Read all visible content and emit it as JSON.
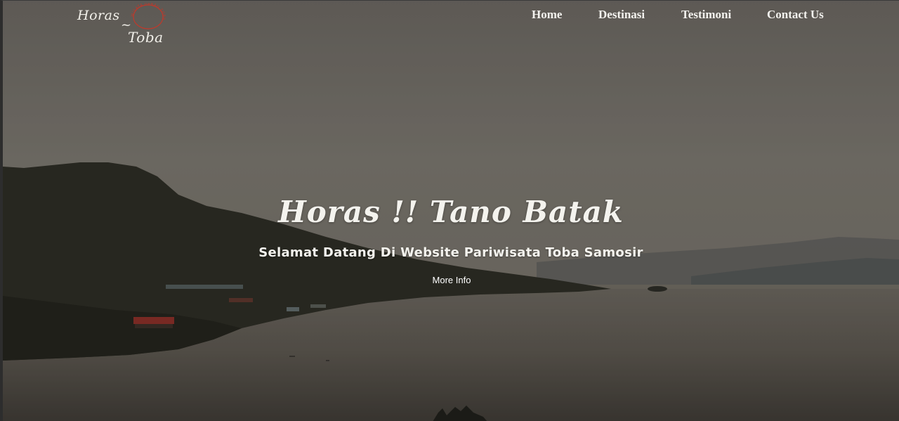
{
  "logo": {
    "line1": "Horas",
    "separator": "~",
    "line2": "Toba",
    "ring_text": "WISATA DANAU TOBA",
    "ring_color": "#c0392b"
  },
  "nav": {
    "items": [
      {
        "label": "Home"
      },
      {
        "label": "Destinasi"
      },
      {
        "label": "Testimoni"
      },
      {
        "label": "Contact Us"
      }
    ]
  },
  "hero": {
    "title": "Horas !! Tano Batak",
    "subtitle": "Selamat Datang Di Website Pariwisata Toba Samosir",
    "cta_label": "More Info",
    "sky_color": "#7b776f",
    "water_color": "#5f5a51"
  }
}
